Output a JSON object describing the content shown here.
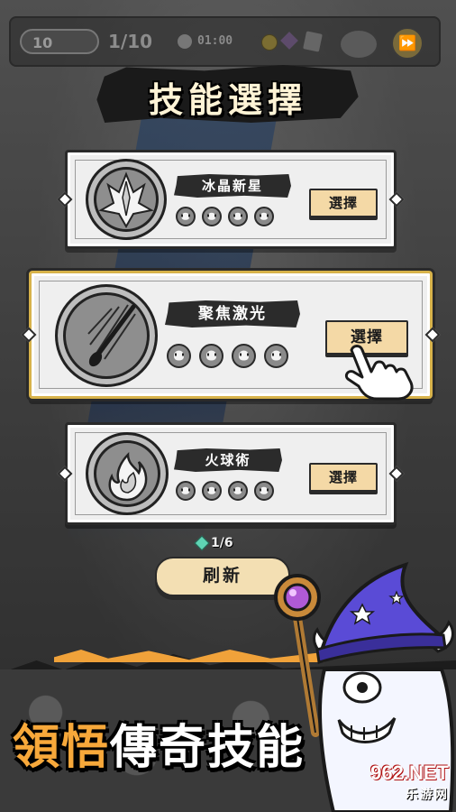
{
  "hud": {
    "level": "10",
    "wave": "1/10",
    "time": "01:00",
    "fast_forward_icon": "fast-forward-icon"
  },
  "title": "技能選擇",
  "skills": [
    {
      "name": "冰晶新星",
      "select_label": "選擇",
      "icon": "ice-crystal-icon",
      "level_slots": 4
    },
    {
      "name": "聚焦激光",
      "select_label": "選擇",
      "icon": "laser-beam-icon",
      "level_slots": 4,
      "highlighted": true
    },
    {
      "name": "火球術",
      "select_label": "選擇",
      "icon": "fireball-icon",
      "level_slots": 4
    }
  ],
  "refresh": {
    "count": "1/6",
    "label": "刷新"
  },
  "promo": {
    "part1": "領悟",
    "part2": "傳奇",
    "part3": "技能"
  },
  "watermark": {
    "main": "962.NET",
    "sub": "乐游网"
  },
  "colors": {
    "select_button": "#f4d9a6",
    "highlight_border": "#d7b24a",
    "promo_accent": "#f7a83a"
  }
}
